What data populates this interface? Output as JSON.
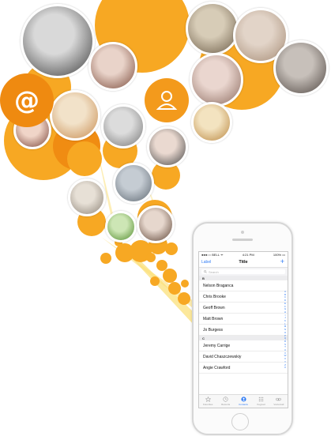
{
  "colors": {
    "orange": "#f7a823",
    "orange_deep": "#f08c12",
    "ios_blue": "#2f7bf5",
    "ray": "#fbe07a"
  },
  "collage": {
    "email_icon_glyph": "@",
    "email_icon_name": "at-sign-icon",
    "contact_icon_name": "person-silhouette-icon"
  },
  "phone": {
    "status": {
      "carrier": "●●●○○ BELL ᯤ",
      "time": "4:21 PM",
      "battery": "100% ▭"
    },
    "nav": {
      "left": "Label",
      "title": "Title",
      "add": "+"
    },
    "search_placeholder": "Search",
    "sections": [
      {
        "letter": "B",
        "contacts": [
          "Nelson Braganca",
          "Chris Brooke",
          "Geoff Brown",
          "Matt Brown",
          "Jo Burgess"
        ]
      },
      {
        "letter": "C",
        "contacts": [
          "Jeremy Carrige",
          "David Chaszczewskiy",
          "Angie Crawford"
        ]
      }
    ],
    "index_letters": [
      "A",
      "B",
      "C",
      "D",
      "E",
      "F",
      "G",
      "H",
      "I",
      "J",
      "K",
      "L",
      "M",
      "N",
      "O",
      "P",
      "Q",
      "R",
      "S",
      "T",
      "U",
      "V",
      "W",
      "X",
      "Y",
      "Z",
      "#"
    ],
    "tabs": [
      {
        "label": "Favorites",
        "icon": "star-icon"
      },
      {
        "label": "Recents",
        "icon": "clock-icon"
      },
      {
        "label": "Contacts",
        "icon": "person-icon",
        "active": true
      },
      {
        "label": "Keypad",
        "icon": "keypad-icon"
      },
      {
        "label": "Voicemail",
        "icon": "voicemail-icon"
      }
    ]
  }
}
